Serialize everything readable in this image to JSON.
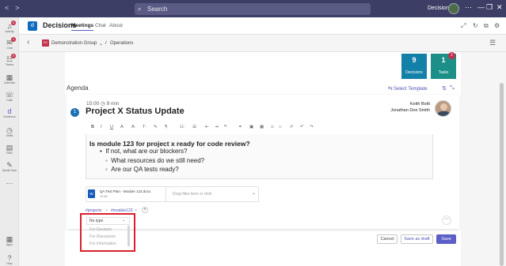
{
  "titlebar": {
    "search_placeholder": "Search",
    "user": "Decisions",
    "more": "⋯",
    "minimize": "—",
    "restore": "❐",
    "close": "✕"
  },
  "rail": [
    {
      "label": "Activity",
      "icon": "bell-icon",
      "glyph": "♫",
      "badge": "6"
    },
    {
      "label": "Chat",
      "icon": "chat-icon",
      "glyph": "✉",
      "badge": "1"
    },
    {
      "label": "Teams",
      "icon": "teams-icon",
      "glyph": "☷",
      "badge": "9"
    },
    {
      "label": "Calendar",
      "icon": "calendar-icon",
      "glyph": "▦",
      "badge": ""
    },
    {
      "label": "Calls",
      "icon": "phone-icon",
      "glyph": "☏",
      "badge": ""
    },
    {
      "label": "Decisions",
      "icon": "decisions-icon",
      "glyph": "d",
      "badge": ""
    },
    {
      "label": "Shifts",
      "icon": "shifts-icon",
      "glyph": "◷",
      "badge": ""
    },
    {
      "label": "Files",
      "icon": "files-icon",
      "glyph": "▤",
      "badge": ""
    },
    {
      "label": "Speak Now",
      "icon": "speak-icon",
      "glyph": "✎",
      "badge": ""
    },
    {
      "label": "",
      "icon": "more-icon",
      "glyph": "⋯",
      "badge": ""
    },
    {
      "label": "Apps",
      "icon": "apps-icon",
      "glyph": "▦",
      "badge": ""
    },
    {
      "label": "Help",
      "icon": "help-icon",
      "glyph": "?",
      "badge": ""
    }
  ],
  "apphead": {
    "title": "Decisions",
    "tabs": [
      "Meetings",
      "Chat",
      "About"
    ]
  },
  "breadcrumb": {
    "group_icon_text": "DG",
    "group": "Demonstration Group",
    "separator": "/",
    "section": "Operations"
  },
  "stats": [
    {
      "value": "9",
      "label": "Decisions",
      "color": "#1380a8"
    },
    {
      "value": "1",
      "label": "Tasks",
      "color": "#1b8f88",
      "badge": "1"
    }
  ],
  "agenda": {
    "title": "Agenda",
    "template_link": "Select Template",
    "item": {
      "number": "1",
      "time": "15:00",
      "duration": "9 min",
      "title": "Project X Status Update",
      "presenters": [
        "Keith Botti",
        "Jonathan Doe Smith"
      ]
    },
    "editor": {
      "question": "Is module 123 for project x ready for code review?",
      "bullets": [
        {
          "level": 1,
          "text": "If not, what are our blockers?"
        },
        {
          "level": 2,
          "text": "What resources do we still need?"
        },
        {
          "level": 2,
          "text": "Are our QA tests ready?"
        }
      ]
    },
    "attachment": {
      "icon_text": "W",
      "name": "QA Test Plan - Module 123.docx",
      "size": "15 KB"
    },
    "dropzone": "Drag files here or click",
    "tags": [
      "#projects",
      "#module123"
    ],
    "type_select": {
      "selected": "No type",
      "options": [
        "For Decision",
        "For Discussion",
        "For Information"
      ]
    }
  },
  "buttons": {
    "cancel": "Cancel",
    "save_draft": "Save as draft",
    "save": "Save"
  }
}
